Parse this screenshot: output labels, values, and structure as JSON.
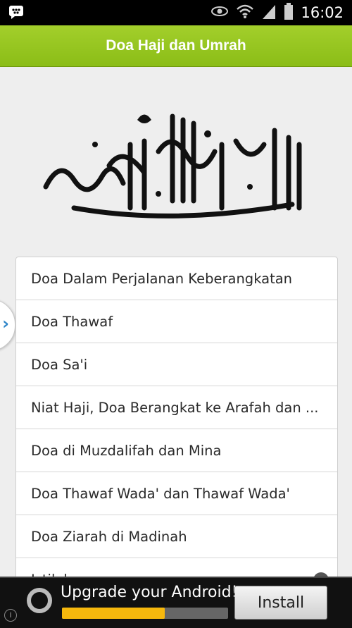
{
  "status_bar": {
    "time": "16:02",
    "icons": [
      "bbm-icon",
      "eye-icon",
      "wifi-icon",
      "signal-icon",
      "battery-icon"
    ]
  },
  "header": {
    "title": "Doa Haji dan Umrah",
    "color": "#95c520"
  },
  "menu": {
    "items": [
      {
        "label": "Doa Dalam Perjalanan Keberangkatan"
      },
      {
        "label": "Doa Thawaf"
      },
      {
        "label": "Doa Sa'i"
      },
      {
        "label": "Niat Haji, Doa Berangkat ke Arafah dan ..."
      },
      {
        "label": "Doa di Muzdalifah dan Mina"
      },
      {
        "label": "Doa Thawaf Wada' dan Thawaf Wada'"
      },
      {
        "label": "Doa Ziarah di Madinah"
      },
      {
        "label": "Istilah"
      }
    ]
  },
  "ad": {
    "title": "Upgrade your Android!",
    "button_label": "Install",
    "progress": 0.62,
    "info_glyph": "i"
  }
}
